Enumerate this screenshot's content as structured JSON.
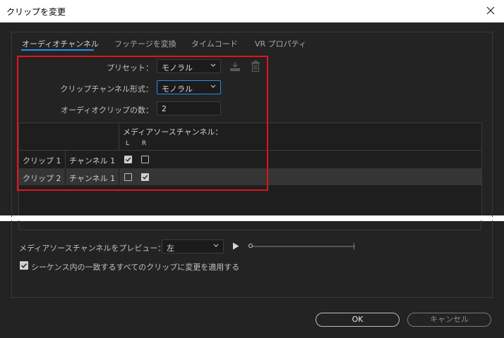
{
  "window": {
    "title": "クリップを変更"
  },
  "tabs": [
    {
      "label": "オーディオチャンネル"
    },
    {
      "label": "フッテージを変換"
    },
    {
      "label": "タイムコード"
    },
    {
      "label": "VR プロパティ"
    }
  ],
  "form": {
    "preset_label": "プリセット：",
    "preset_value": "モノラル",
    "clip_channel_format_label": "クリップチャンネル形式：",
    "clip_channel_format_value": "モノラル",
    "audio_clip_count_label": "オーディオクリップの数：",
    "audio_clip_count_value": "2"
  },
  "table": {
    "source_channel_header": "メディアソースチャンネル：",
    "column_headers": [
      "L",
      "R"
    ],
    "rows": [
      {
        "clip": "クリップ 1",
        "channel": "チャンネル 1",
        "L": true,
        "R": false
      },
      {
        "clip": "クリップ 2",
        "channel": "チャンネル 1",
        "L": false,
        "R": true
      }
    ]
  },
  "preview": {
    "label": "メディアソースチャンネルをプレビュー：",
    "value": "左",
    "progress": 0.0
  },
  "apply_all": {
    "checked": true,
    "label": "シーケンス内の一致するすべてのクリップに変更を適用する"
  },
  "buttons": {
    "ok": "OK",
    "cancel": "キャンセル"
  },
  "colors": {
    "accent": "#2d8ceb",
    "highlight": "#e0141e",
    "background": "#232323"
  }
}
